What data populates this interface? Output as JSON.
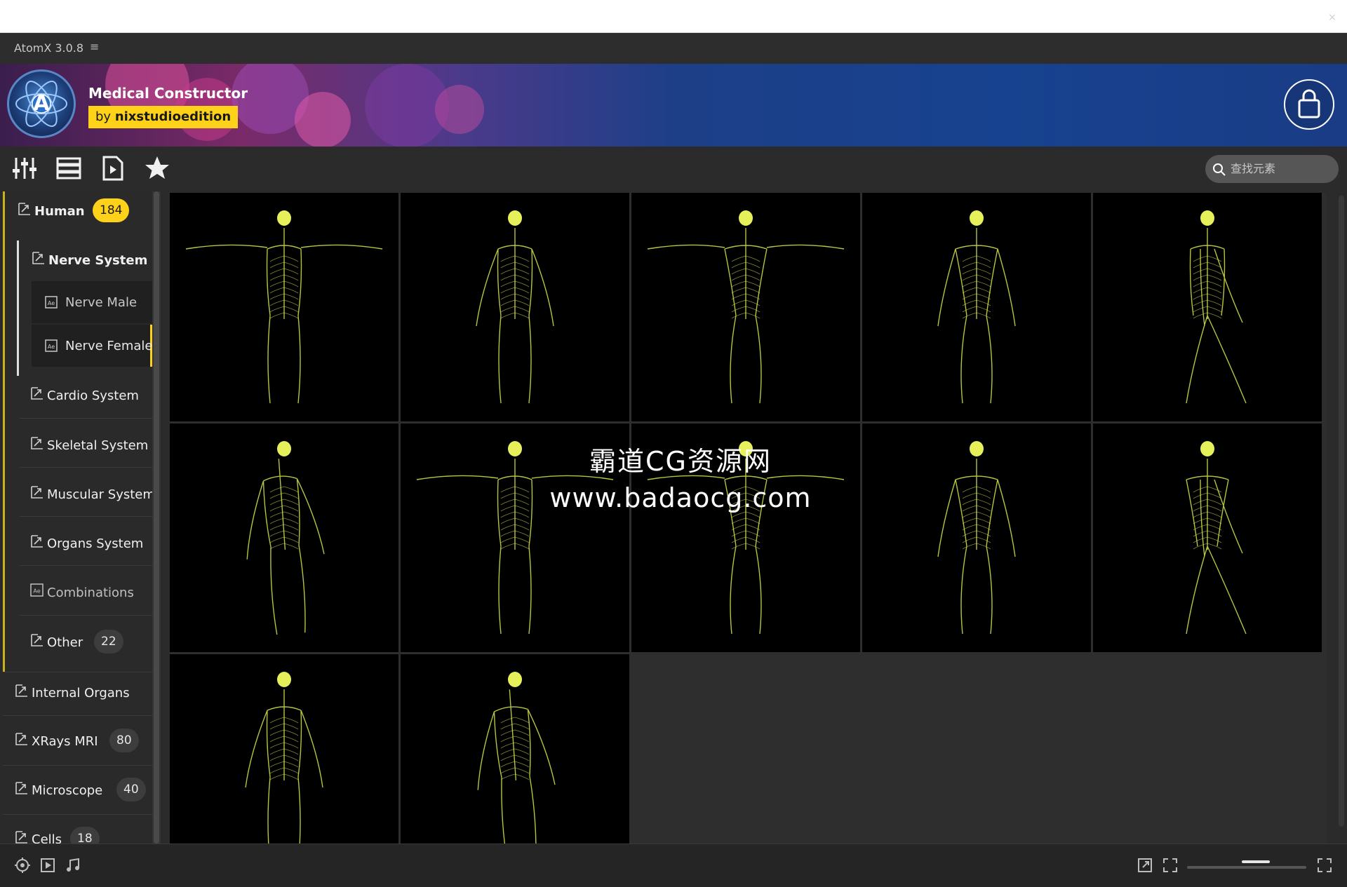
{
  "app": {
    "title": "AtomX 3.0.8",
    "menu_glyph": "≡",
    "close_glyph": "×"
  },
  "banner": {
    "product_name": "Medical Constructor",
    "by_prefix": "by",
    "by_author": "nixstudioedition",
    "logo_letter": "A"
  },
  "toolbar": {
    "buttons": [
      "sliders-icon",
      "list-view-icon",
      "video-file-icon",
      "favorites-star-icon"
    ],
    "search": {
      "placeholder": "查找元素"
    }
  },
  "sidebar": {
    "human": {
      "label": "Human",
      "count": "184"
    },
    "nerve_system": {
      "label": "Nerve System"
    },
    "leaves": [
      {
        "label": "Nerve Male"
      },
      {
        "label": "Nerve Female"
      }
    ],
    "subcategories": [
      {
        "label": "Cardio System"
      },
      {
        "label": "Skeletal System"
      },
      {
        "label": "Muscular System"
      },
      {
        "label": "Organs System"
      },
      {
        "label": "Combinations"
      },
      {
        "label": "Other",
        "count": "22"
      }
    ],
    "top_categories": [
      {
        "label": "Internal Organs"
      },
      {
        "label": "XRays MRI",
        "count": "80"
      },
      {
        "label": "Microscope",
        "count": "40"
      },
      {
        "label": "Cells",
        "count": "18"
      }
    ]
  },
  "grid": {
    "items": [
      {
        "pose": "t-pose",
        "sex": "female"
      },
      {
        "pose": "a-pose",
        "sex": "female"
      },
      {
        "pose": "t-pose",
        "sex": "male"
      },
      {
        "pose": "a-pose",
        "sex": "male"
      },
      {
        "pose": "walk-side",
        "sex": "female"
      },
      {
        "pose": "three-quarter",
        "sex": "female"
      },
      {
        "pose": "t-pose",
        "sex": "female"
      },
      {
        "pose": "t-pose-back",
        "sex": "male"
      },
      {
        "pose": "a-pose",
        "sex": "male"
      },
      {
        "pose": "walk-side",
        "sex": "male"
      },
      {
        "pose": "a-pose",
        "sex": "female"
      },
      {
        "pose": "three-quarter-back",
        "sex": "female"
      }
    ]
  },
  "watermark": {
    "line1": "霸道CG资源网",
    "line2": "www.badaocg.com"
  },
  "colors": {
    "accent_yellow": "#ffd21a",
    "nerve_glow": "#d8e64a",
    "banner_blue": "#17428f"
  }
}
